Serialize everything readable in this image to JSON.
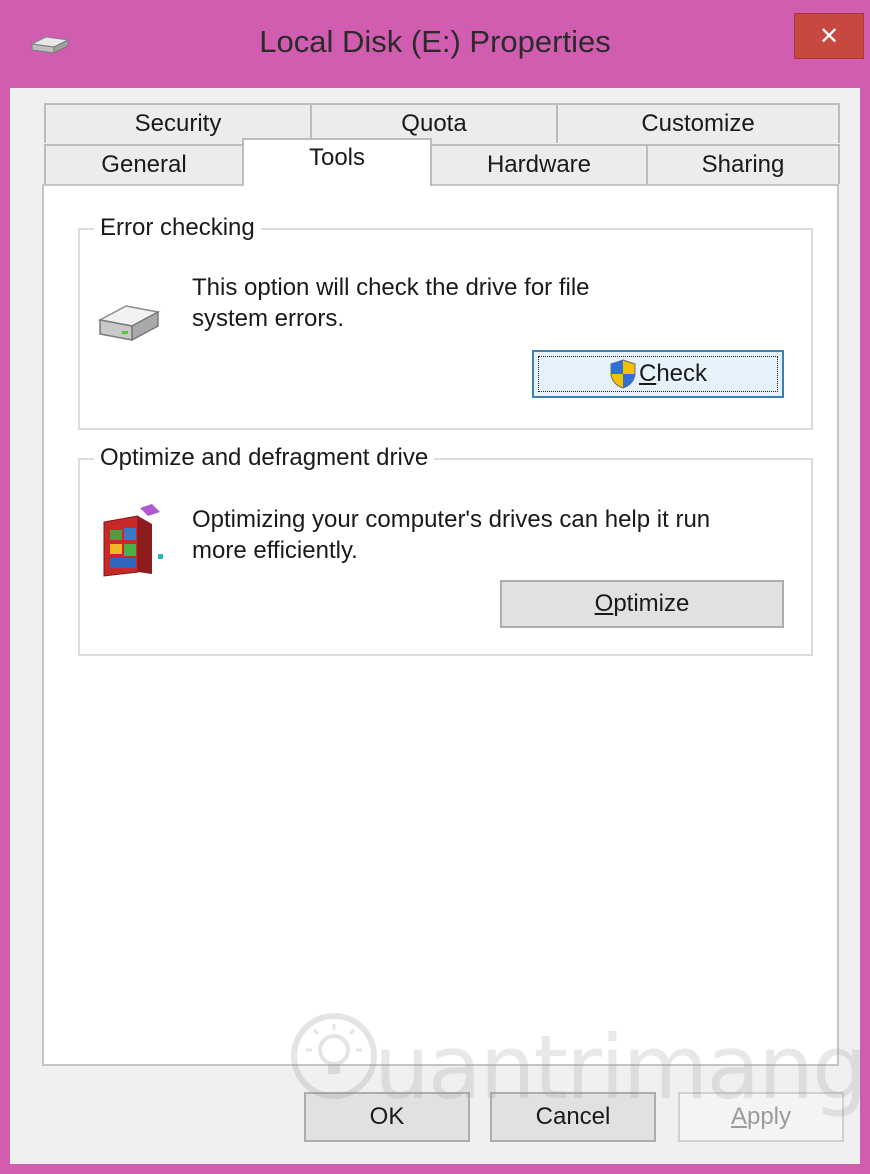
{
  "window": {
    "title": "Local Disk (E:) Properties",
    "close_glyph": "✕"
  },
  "tabs": {
    "row_top": [
      {
        "label": "Security"
      },
      {
        "label": "Quota"
      },
      {
        "label": "Customize"
      }
    ],
    "row_bottom": [
      {
        "label": "General"
      },
      {
        "label": "Tools",
        "active": true
      },
      {
        "label": "Hardware"
      },
      {
        "label": "Sharing"
      }
    ]
  },
  "error_checking": {
    "title": "Error checking",
    "description_line1": "This option will check the drive for file",
    "description_line2": "system errors.",
    "button_mnemonic": "C",
    "button_rest": "heck",
    "icon": "hard-drive-icon"
  },
  "optimize": {
    "title": "Optimize and defragment drive",
    "description_line1": "Optimizing your computer's drives can help it run",
    "description_line2": "more efficiently.",
    "button_mnemonic": "O",
    "button_rest": "ptimize",
    "icon": "defrag-icon"
  },
  "footer": {
    "ok_label": "OK",
    "cancel_label": "Cancel",
    "apply_mnemonic": "A",
    "apply_rest": "pply"
  },
  "watermark": {
    "text": "uantrimang"
  },
  "colors": {
    "frame": "#d15db0",
    "close_button": "#c7483f",
    "focus_border": "#3c7fb1"
  }
}
